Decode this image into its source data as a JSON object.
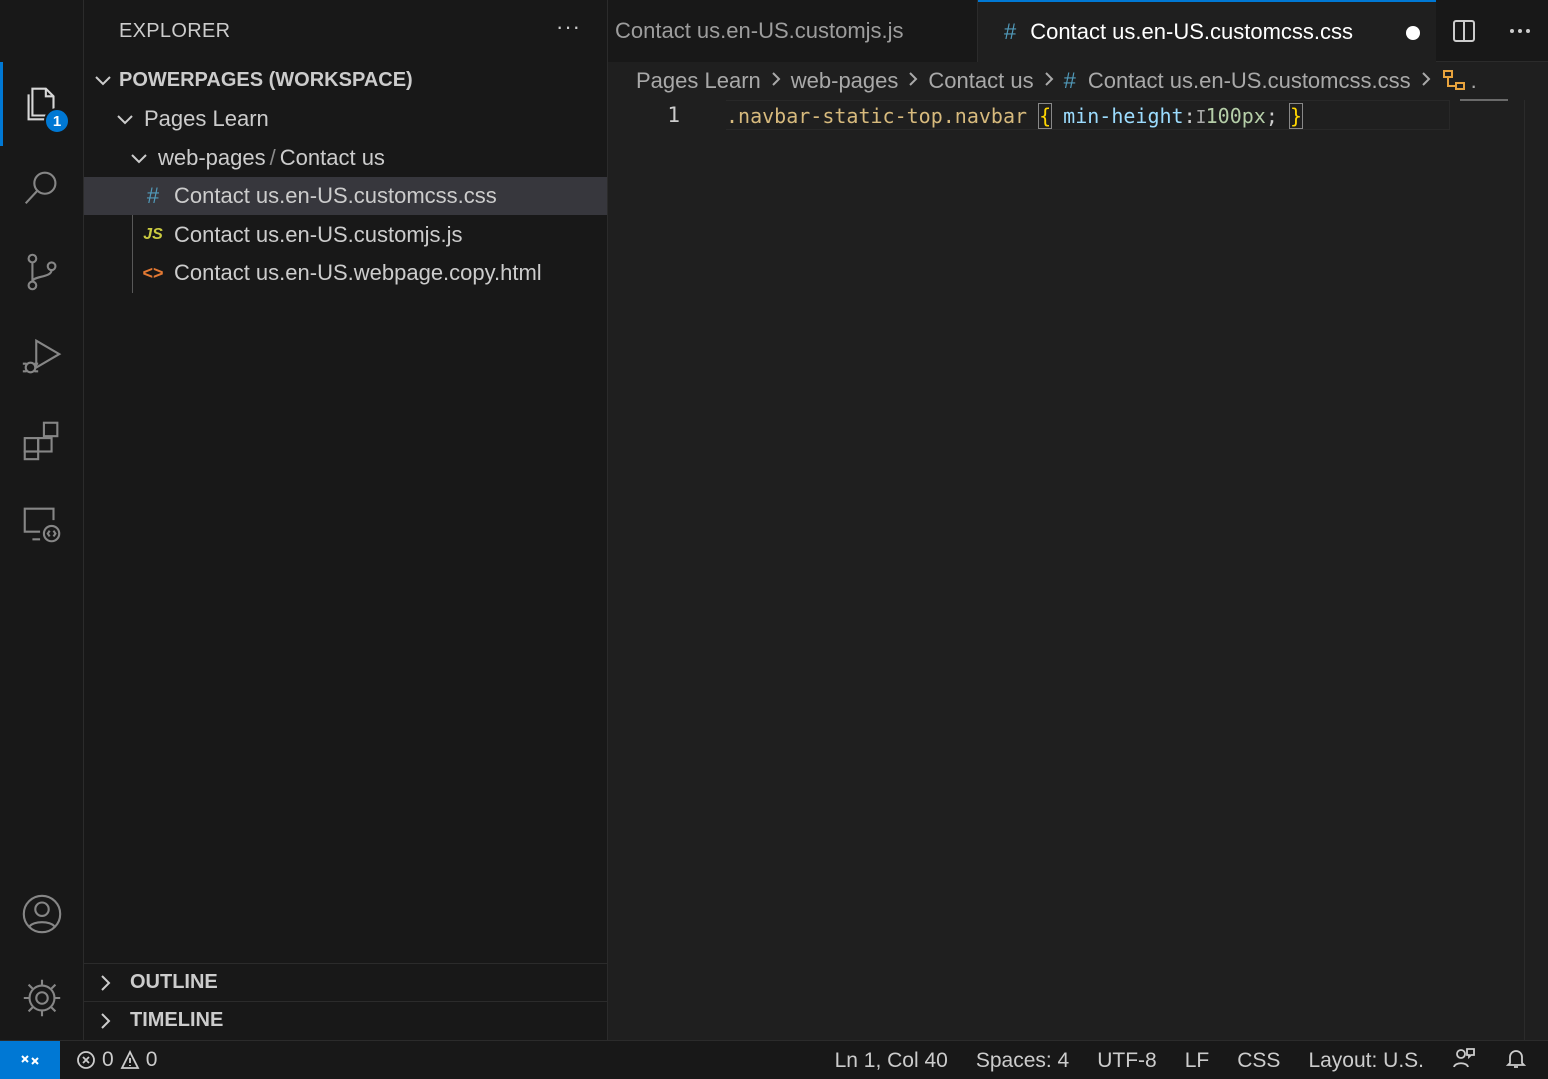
{
  "sidebar": {
    "title": "EXPLORER",
    "more": "···",
    "workspace": "POWERPAGES (WORKSPACE)",
    "folder": "Pages Learn",
    "subfolder_a": "web-pages",
    "subfolder_sep": "/",
    "subfolder_b": "Contact us",
    "files": [
      {
        "icon": "#",
        "name": "Contact us.en-US.customcss.css"
      },
      {
        "icon": "JS",
        "name": "Contact us.en-US.customjs.js"
      },
      {
        "icon": "<>",
        "name": "Contact us.en-US.webpage.copy.html"
      }
    ],
    "outline": "OUTLINE",
    "timeline": "TIMELINE"
  },
  "activity": {
    "explorer_badge": "1"
  },
  "tabs": [
    {
      "label": "Contact us.en-US.customjs.js"
    },
    {
      "icon": "#",
      "label": "Contact us.en-US.customcss.css"
    }
  ],
  "breadcrumb": {
    "items": [
      "Pages Learn",
      "web-pages",
      "Contact us"
    ],
    "file_icon": "#",
    "file": "Contact us.en-US.customcss.css",
    "tail": "."
  },
  "editor": {
    "line_number": "1",
    "tokens": {
      "selector": ".navbar-static-top.navbar",
      "open_brace": "{",
      "property": "min-height",
      "colon": ":",
      "value": "100px",
      "semicolon": ";",
      "close_brace": "}"
    }
  },
  "status": {
    "errors": "0",
    "warnings": "0",
    "position": "Ln 1, Col 40",
    "spaces": "Spaces: 4",
    "encoding": "UTF-8",
    "eol": "LF",
    "language": "CSS",
    "layout": "Layout: U.S."
  },
  "colors": {
    "accent": "#0078d4",
    "css_icon": "#519aba",
    "js_icon": "#cbcb41",
    "html_icon": "#e37933"
  }
}
